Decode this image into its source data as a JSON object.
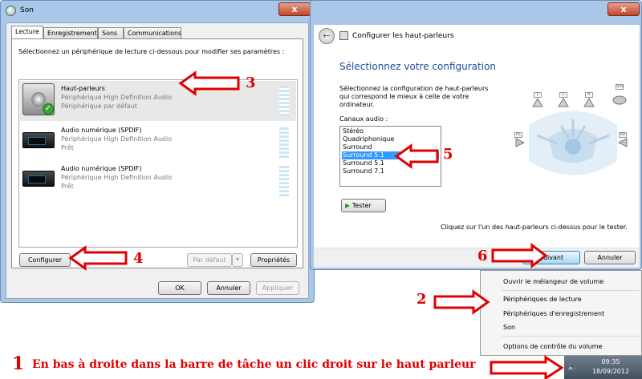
{
  "son": {
    "title": "Son",
    "close": "x",
    "tabs": [
      "Lecture",
      "Enregistrement",
      "Sons",
      "Communications"
    ],
    "instruction": "Sélectionnez un périphérique de lecture ci-dessous pour modifier ses paramètres :",
    "devices": [
      {
        "name": "Haut-parleurs",
        "driver": "Périphérique High Definition Audio",
        "status": "Périphérique par défaut",
        "icon": "speaker-icon",
        "default": true
      },
      {
        "name": "Audio numérique (SPDIF)",
        "driver": "Périphérique High Definition Audio",
        "status": "Prêt",
        "icon": "spdif-device-icon",
        "default": false
      },
      {
        "name": "Audio numérique (SPDIF)",
        "driver": "Périphérique High Definition Audio",
        "status": "Prêt",
        "icon": "spdif-device-icon",
        "default": false
      }
    ],
    "buttons": {
      "configure": "Configurer",
      "default": "Par défaut",
      "properties": "Propriétés",
      "ok": "OK",
      "cancel": "Annuler",
      "apply": "Appliquer"
    }
  },
  "config": {
    "title": "Configurer les haut-parleurs",
    "close": "x",
    "heading": "Sélectionnez votre configuration",
    "description": "Sélectionnez la configuration de haut-parleurs qui correspond le mieux à celle de votre ordinateur.",
    "channels_label": "Canaux audio :",
    "channels": [
      "Stéréo",
      "Quadriphonique",
      "Surround",
      "Surround 5.1",
      "Surround 5.1",
      "Surround 7.1"
    ],
    "selected_index": 3,
    "test_button": "Tester",
    "hint": "Cliquez sur l'un des haut-parleurs ci-dessus pour le tester.",
    "next_button": "Suivant",
    "cancel_button": "Annuler"
  },
  "context_menu": {
    "items": [
      "Ouvrir le mélangeur de volume",
      "Périphériques de lecture",
      "Périphériques d'enregistrement",
      "Son",
      "Options de contrôle du volume"
    ]
  },
  "taskbar": {
    "time": "09:35",
    "date": "18/09/2012"
  },
  "annotations": {
    "n1": "1",
    "n2": "2",
    "n3": "3",
    "n4": "4",
    "n5": "5",
    "n6": "6",
    "instruction": "En bas à droite dans la barre de tâche un clic droit sur le haut parleur"
  },
  "colors": {
    "annotation_red": "#e00000",
    "selection_blue": "#3399ff",
    "window_frame": "#a9c7e8",
    "heading_blue": "#1f4e96"
  }
}
